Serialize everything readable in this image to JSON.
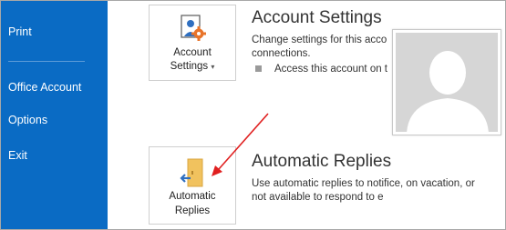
{
  "sidebar": {
    "items": [
      {
        "label": "Print"
      },
      {
        "label": "Office Account"
      },
      {
        "label": "Options"
      },
      {
        "label": "Exit"
      }
    ]
  },
  "account_settings": {
    "button_line1": "Account",
    "button_line2": "Settings",
    "dropdown_glyph": "▾",
    "title": "Account Settings",
    "description_line1": "Change settings for this acco",
    "description_line2": "connections.",
    "bullet_text": "Access this account on t"
  },
  "automatic_replies": {
    "button_line1": "Automatic",
    "button_line2": "Replies",
    "title": "Automatic Replies",
    "description_line1": "Use automatic replies to notifice, on vacation, or",
    "description_line2": "not available to respond to e"
  },
  "colors": {
    "sidebar_bg": "#0a6bc4",
    "annotation_arrow": "#e02020",
    "gear_orange": "#e8742a",
    "arrow_blue": "#2f6fc0"
  },
  "icons": {
    "account_settings": "person-gear-icon",
    "automatic_replies": "door-arrow-icon",
    "profile_photo": "person-silhouette-icon"
  }
}
